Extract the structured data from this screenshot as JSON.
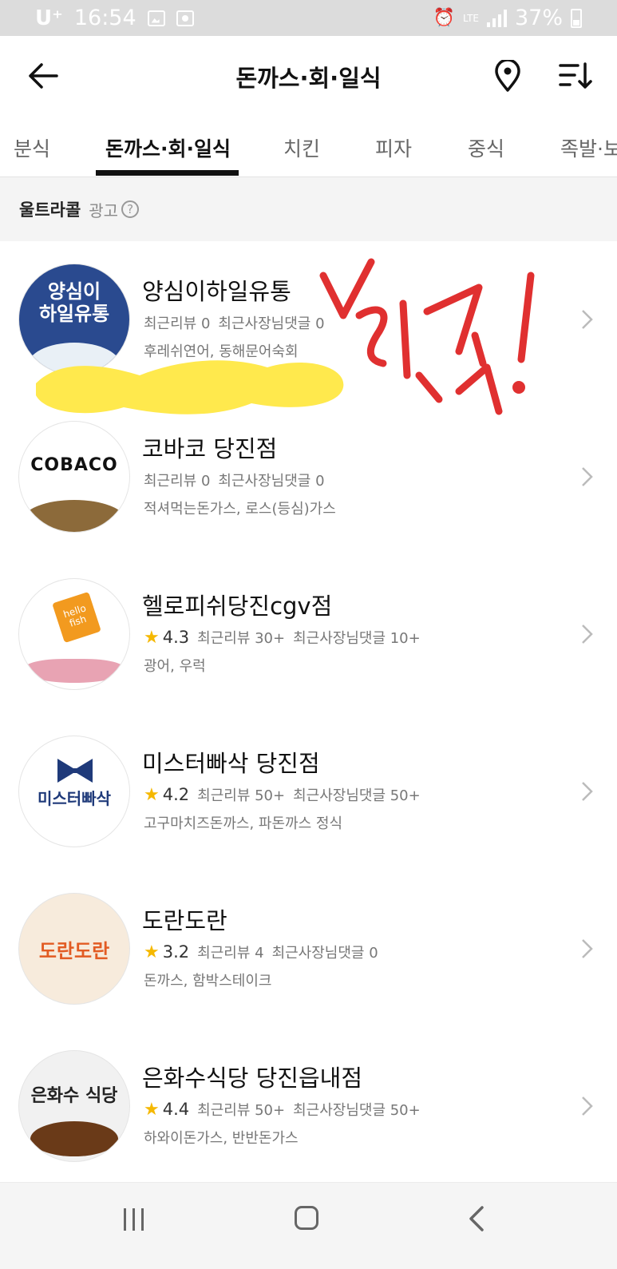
{
  "status_bar": {
    "carrier": "U⁺",
    "time": "16:54",
    "network": "LTE",
    "battery": "37%"
  },
  "header": {
    "title": "돈까스·회·일식",
    "icons": [
      "back-arrow-icon",
      "location-pin-icon",
      "sort-icon"
    ]
  },
  "tabs": [
    {
      "label": "분식",
      "active": false
    },
    {
      "label": "돈까스·회·일식",
      "active": true
    },
    {
      "label": "치킨",
      "active": false
    },
    {
      "label": "피자",
      "active": false
    },
    {
      "label": "중식",
      "active": false
    },
    {
      "label": "족발·보",
      "active": false
    }
  ],
  "section": {
    "title": "울트라콜",
    "ad_label": "광고",
    "help_icon": "?"
  },
  "restaurants": [
    {
      "name": "양심이하일유통",
      "logo_text": "양심이\n하일유통",
      "rating": "",
      "reviews": "최근리뷰 0",
      "owner_replies": "최근사장님댓글 0",
      "menu": "후레쉬연어, 동해문어숙회"
    },
    {
      "name": "코바코 당진점",
      "logo_text": "COBACO",
      "rating": "",
      "reviews": "최근리뷰 0",
      "owner_replies": "최근사장님댓글 0",
      "menu": "적셔먹는돈가스, 로스(등심)가스"
    },
    {
      "name": "헬로피쉬당진cgv점",
      "logo_text": "hello fish",
      "rating": "4.3",
      "reviews": "최근리뷰 30+",
      "owner_replies": "최근사장님댓글 10+",
      "menu": "광어, 우럭"
    },
    {
      "name": "미스터빠삭 당진점",
      "logo_text": "미스터빠삭",
      "rating": "4.2",
      "reviews": "최근리뷰 50+",
      "owner_replies": "최근사장님댓글 50+",
      "menu": "고구마치즈돈까스, 파돈까스 정식"
    },
    {
      "name": "도란도란",
      "logo_text": "도란도란",
      "rating": "3.2",
      "reviews": "최근리뷰 4",
      "owner_replies": "최근사장님댓글 0",
      "menu": "돈까스, 함박스테이크"
    },
    {
      "name": "은화수식당 당진읍내점",
      "logo_text": "은화수 식당",
      "rating": "4.4",
      "reviews": "최근리뷰 50+",
      "owner_replies": "최근사장님댓글 50+",
      "menu": "하와이돈가스, 반반돈가스"
    }
  ],
  "colors": {
    "accent_text": "#111111",
    "star": "#f5b800",
    "annotation_red": "#e03030",
    "scribble_yellow": "#ffe94d"
  }
}
